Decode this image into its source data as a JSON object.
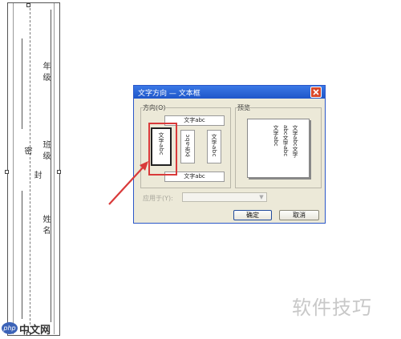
{
  "document": {
    "fields": [
      "年级",
      "班级",
      "姓名"
    ],
    "binding_chars": [
      "密",
      "封"
    ]
  },
  "dialog": {
    "title": "文字方向 — 文本框",
    "direction_label": "方向(O)",
    "preview_label": "预览",
    "options": {
      "horizontal": "文字abc",
      "vertical_selected": "文字abc",
      "vertical_rotated": "文字abc",
      "vertical_right": "文字abc",
      "horizontal_bottom": "文字abc"
    },
    "preview_lines": [
      "文字abc文字",
      "abc文字abc",
      "文字abc"
    ],
    "apply_to_label": "应用于(Y):",
    "apply_to_value": "",
    "ok_label": "确定",
    "cancel_label": "取消"
  },
  "colors": {
    "annotation": "#d93a3a",
    "titlebar": "#2b62d6"
  },
  "watermark": {
    "text": "软件技巧",
    "logo": "php",
    "site": "中文网"
  }
}
